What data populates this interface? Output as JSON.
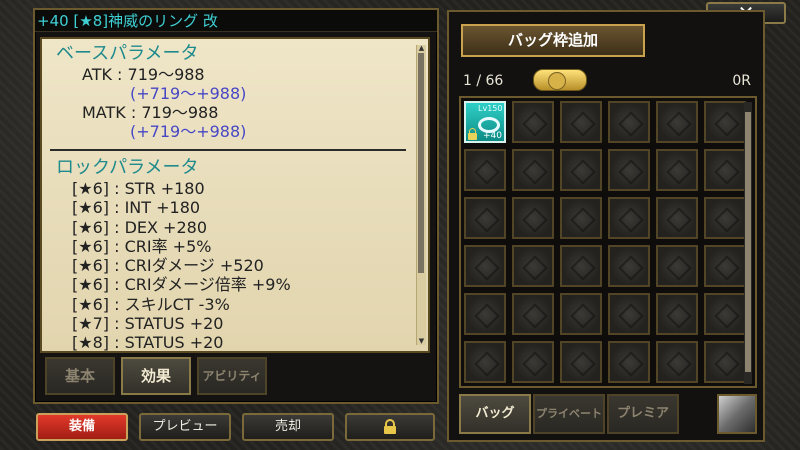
{
  "item": {
    "title": "+40 [★8]神威のリング 改"
  },
  "base": {
    "heading": "ベースパラメータ",
    "atk_label": "ATK : 719～988",
    "atk_bonus_prefix": "(",
    "atk_bonus_a": "+719",
    "atk_bonus_sep": "～",
    "atk_bonus_b": "+988",
    "atk_bonus_suffix": ")",
    "matk_label": "MATK : 719～988",
    "matk_bonus_a": "+719",
    "matk_bonus_b": "+988"
  },
  "lock": {
    "heading": "ロックパラメータ",
    "lines": [
      {
        "stars": "[★6]",
        "text": " : STR +180"
      },
      {
        "stars": "[★6]",
        "text": " : INT +180"
      },
      {
        "stars": "[★6]",
        "text": " : DEX +280"
      },
      {
        "stars": "[★6]",
        "text": " : CRI率 +5%"
      },
      {
        "stars": "[★6]",
        "text": " : CRIダメージ +520"
      },
      {
        "stars": "[★6]",
        "text": " : CRIダメージ倍率 +9%"
      },
      {
        "stars": "[★6]",
        "text": " : スキルCT -3%"
      },
      {
        "stars": "[★7]",
        "text": " : STATUS +20"
      },
      {
        "stars": "[★8]",
        "text": " : STATUS +20"
      }
    ]
  },
  "left_tabs": [
    "基本",
    "効果",
    "アビリティ"
  ],
  "left_active_tab": 1,
  "buttons": {
    "equip": "装備",
    "preview": "プレビュー",
    "sell": "売却"
  },
  "bag": {
    "add_button": "バッグ枠追加",
    "count": "1 / 66",
    "money": "0R",
    "first_item": {
      "level": "Lv150",
      "plus": "+40"
    },
    "tabs": [
      "バッグ",
      "プライベート",
      "プレミア"
    ],
    "active_tab": 0
  },
  "icons": {
    "close": "close-icon",
    "lock": "padlock-icon",
    "coin": "coin-icon",
    "tool": "tool-icon"
  },
  "colors": {
    "title": "#3fd0d4",
    "section": "#1f8a8c",
    "bonus": "#4747c6",
    "equip": "#e23a2a"
  }
}
